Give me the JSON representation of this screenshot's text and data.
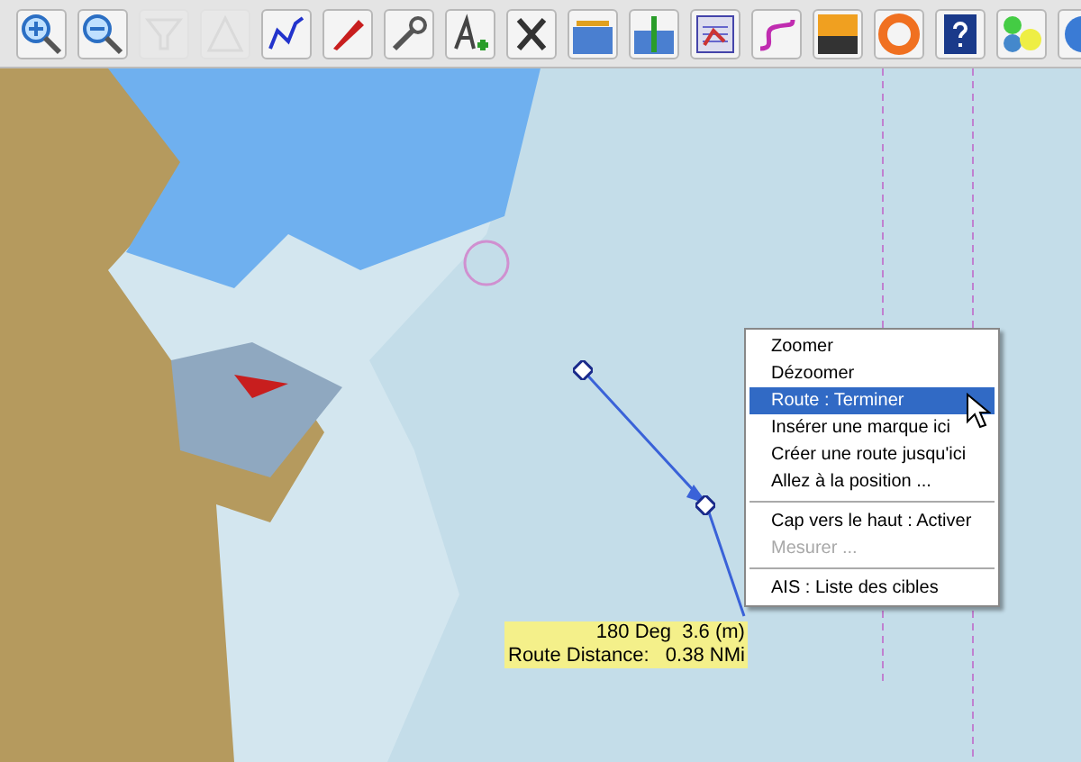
{
  "toolbar": {
    "tools": [
      {
        "disabled": false
      },
      {
        "disabled": false
      },
      {
        "disabled": true
      },
      {
        "disabled": true
      },
      {
        "disabled": false
      },
      {
        "disabled": false
      },
      {
        "disabled": false
      },
      {
        "disabled": false
      },
      {
        "disabled": false
      },
      {
        "disabled": false
      },
      {
        "disabled": false
      },
      {
        "disabled": false
      },
      {
        "disabled": false
      },
      {
        "disabled": false
      },
      {
        "disabled": false
      },
      {
        "disabled": false
      },
      {
        "disabled": false
      },
      {
        "disabled": false
      }
    ]
  },
  "context_menu": {
    "items": [
      {
        "kind": "item",
        "label": "Zoomer",
        "selected": false,
        "disabled": false
      },
      {
        "kind": "item",
        "label": "Dézoomer",
        "selected": false,
        "disabled": false
      },
      {
        "kind": "item",
        "label": "Route : Terminer",
        "selected": true,
        "disabled": false
      },
      {
        "kind": "item",
        "label": "Insérer une marque ici",
        "selected": false,
        "disabled": false
      },
      {
        "kind": "item",
        "label": "Créer une route jusqu'ici",
        "selected": false,
        "disabled": false
      },
      {
        "kind": "item",
        "label": "Allez à la position ...",
        "selected": false,
        "disabled": false
      },
      {
        "kind": "separator"
      },
      {
        "kind": "item",
        "label": "Cap vers le haut : Activer",
        "selected": false,
        "disabled": false
      },
      {
        "kind": "item",
        "label": "Mesurer ...",
        "selected": false,
        "disabled": true
      },
      {
        "kind": "separator"
      },
      {
        "kind": "item",
        "label": "AIS : Liste des cibles",
        "selected": false,
        "disabled": false
      }
    ]
  },
  "route_label": {
    "bearing": "180 Deg  3.6 (m)",
    "distance": "Route Distance:   0.38 NMi"
  }
}
